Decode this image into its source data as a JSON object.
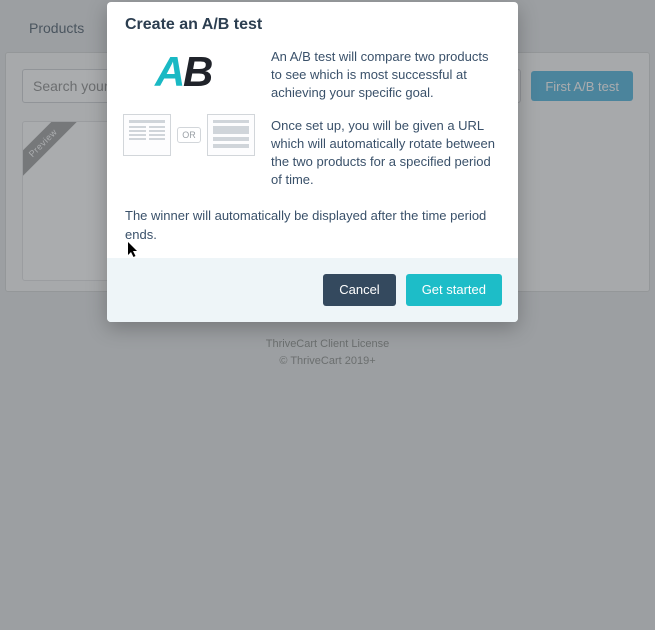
{
  "page": {
    "tab_label": "Products",
    "search_placeholder": "Search your A",
    "cta_button": "First A/B test",
    "card_ribbon": "Preview"
  },
  "footer": {
    "line1": "ThriveCart Client License",
    "line2": "© ThriveCart 2019+"
  },
  "modal": {
    "title": "Create an A/B test",
    "illustration": {
      "or_label": "OR"
    },
    "paragraph1": "An A/B test will compare two products to see which is most successful at achieving your specific goal.",
    "paragraph2": "Once set up, you will be given a URL which will automatically rotate between the two products for a specified period of time.",
    "paragraph3": "The winner will automatically be displayed after the time period ends.",
    "buttons": {
      "cancel": "Cancel",
      "confirm": "Get started"
    }
  }
}
